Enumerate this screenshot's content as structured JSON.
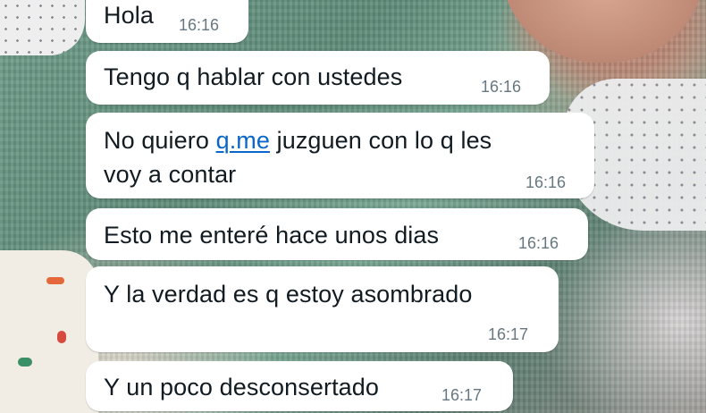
{
  "chat": {
    "messages": [
      {
        "text": "Hola",
        "time": "16:16"
      },
      {
        "text": "Tengo q hablar con ustedes",
        "time": "16:16"
      },
      {
        "line1_pre": "No quiero ",
        "line1_link": "q.me",
        "line1_post": " juzguen con lo q les",
        "line2": "voy a contar",
        "time": "16:16"
      },
      {
        "text": "Esto me enteré hace unos dias",
        "time": "16:16"
      },
      {
        "text": "Y la verdad es q estoy asombrado",
        "time": "16:17"
      },
      {
        "text": "Y un poco desconsertado",
        "time": "16:17"
      }
    ]
  },
  "colors": {
    "bubble": "#ffffff",
    "text": "#111b21",
    "timestamp": "#667781",
    "link": "#0a66c8"
  }
}
